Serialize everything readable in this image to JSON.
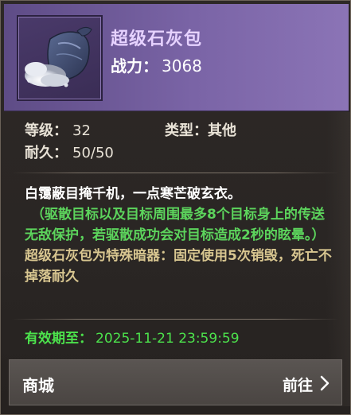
{
  "item": {
    "name": "超级石灰包",
    "power_label": "战力：",
    "power_value": "3068",
    "icon": "lime-powder-pouch-icon"
  },
  "stats": {
    "level_label": "等级：",
    "level_value": "32",
    "type_label": "类型：",
    "type_value": "其他",
    "durability_label": "耐久：",
    "durability_value": "50/50"
  },
  "description": {
    "main": "白霭蔽目掩千机，一点寒芒破玄衣。",
    "effect": "（驱散目标以及目标周围最多8个目标身上的传送无敌保护，若驱散成功会对目标造成2秒的眩晕。）",
    "note": "超级石灰包为特殊暗器：固定使用5次销毁，死亡不掉落耐久"
  },
  "expiry": {
    "label": "有效期至：",
    "value": "2025-11-21 23:59:59"
  },
  "shop": {
    "label": "商城",
    "go_label": "前往",
    "chevron_icon": "chevron-right-icon"
  },
  "colors": {
    "header_purple": "#7a64a6",
    "name_color": "#e6d2ff",
    "effect_green": "#5cd45c",
    "note_gold": "#d8c690",
    "expiry_green": "#4ce24c"
  }
}
